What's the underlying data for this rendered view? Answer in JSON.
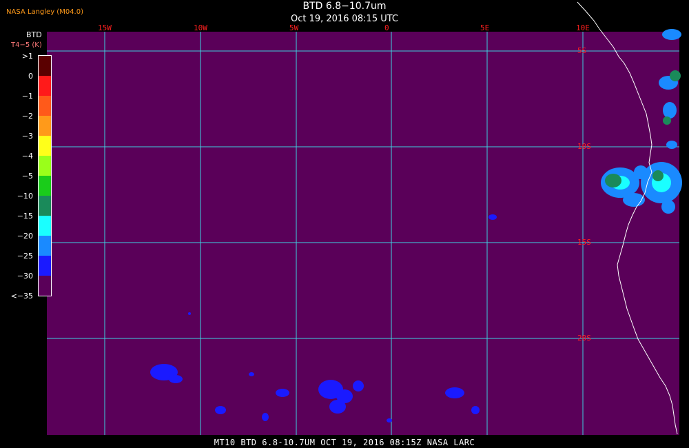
{
  "source_label": "NASA Langley (M04.0)",
  "title": "BTD 6.8−10.7um",
  "subtitle": "Oct 19, 2016 08:15 UTC",
  "legend": {
    "title": "BTD",
    "unit": "T4−5 (K)",
    "levels": [
      {
        "label": ">1",
        "color": "#5a0000"
      },
      {
        "label": "0",
        "color": "#ff1a1a"
      },
      {
        "label": "−1",
        "color": "#ff5a1a"
      },
      {
        "label": "−2",
        "color": "#ff9a1a"
      },
      {
        "label": "−3",
        "color": "#ffff1a"
      },
      {
        "label": "−4",
        "color": "#9aff1a"
      },
      {
        "label": "−5",
        "color": "#1acc1a"
      },
      {
        "label": "−10",
        "color": "#1a8a5a"
      },
      {
        "label": "−15",
        "color": "#1affff"
      },
      {
        "label": "−20",
        "color": "#1a8aff"
      },
      {
        "label": "−25",
        "color": "#1a1aff"
      },
      {
        "label": "−30",
        "color": "#5a0059"
      },
      {
        "label": "<−35",
        "color": ""
      }
    ]
  },
  "map": {
    "background_color": "#5a0059",
    "grid_color": "#3fd0e0",
    "coast_color": "#ffffff",
    "longitude_labels": [
      "15W",
      "10W",
      "5W",
      "0",
      "5E",
      "10E"
    ],
    "latitude_labels": [
      "5S",
      "10S",
      "15S",
      "20S"
    ]
  },
  "footer": "MT10  BTD 6.8-10.7UM  OCT 19, 2016 08:15Z  NASA LARC"
}
